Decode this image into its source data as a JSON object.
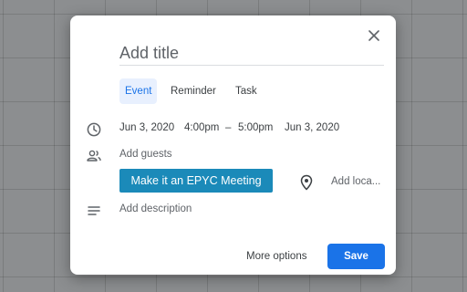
{
  "dialog": {
    "title_placeholder": "Add title",
    "close_icon": "close-icon"
  },
  "tabs": [
    {
      "label": "Event",
      "active": true
    },
    {
      "label": "Reminder",
      "active": false
    },
    {
      "label": "Task",
      "active": false
    }
  ],
  "datetime": {
    "icon": "clock-icon",
    "start_date": "Jun 3, 2020",
    "start_time": "4:00pm",
    "separator": "–",
    "end_time": "5:00pm",
    "end_date": "Jun 3, 2020"
  },
  "guests": {
    "icon": "people-icon",
    "placeholder": "Add guests"
  },
  "epyc": {
    "label": "Make it an EPYC Meeting",
    "color": "#1b8ab9"
  },
  "location": {
    "icon": "location-pin-icon",
    "placeholder": "Add loca..."
  },
  "description": {
    "icon": "description-lines-icon",
    "placeholder": "Add description"
  },
  "footer": {
    "more_options_label": "More options",
    "save_label": "Save"
  },
  "colors": {
    "accent": "#1a73e8",
    "active_tab_bg": "#e8f0fe"
  }
}
